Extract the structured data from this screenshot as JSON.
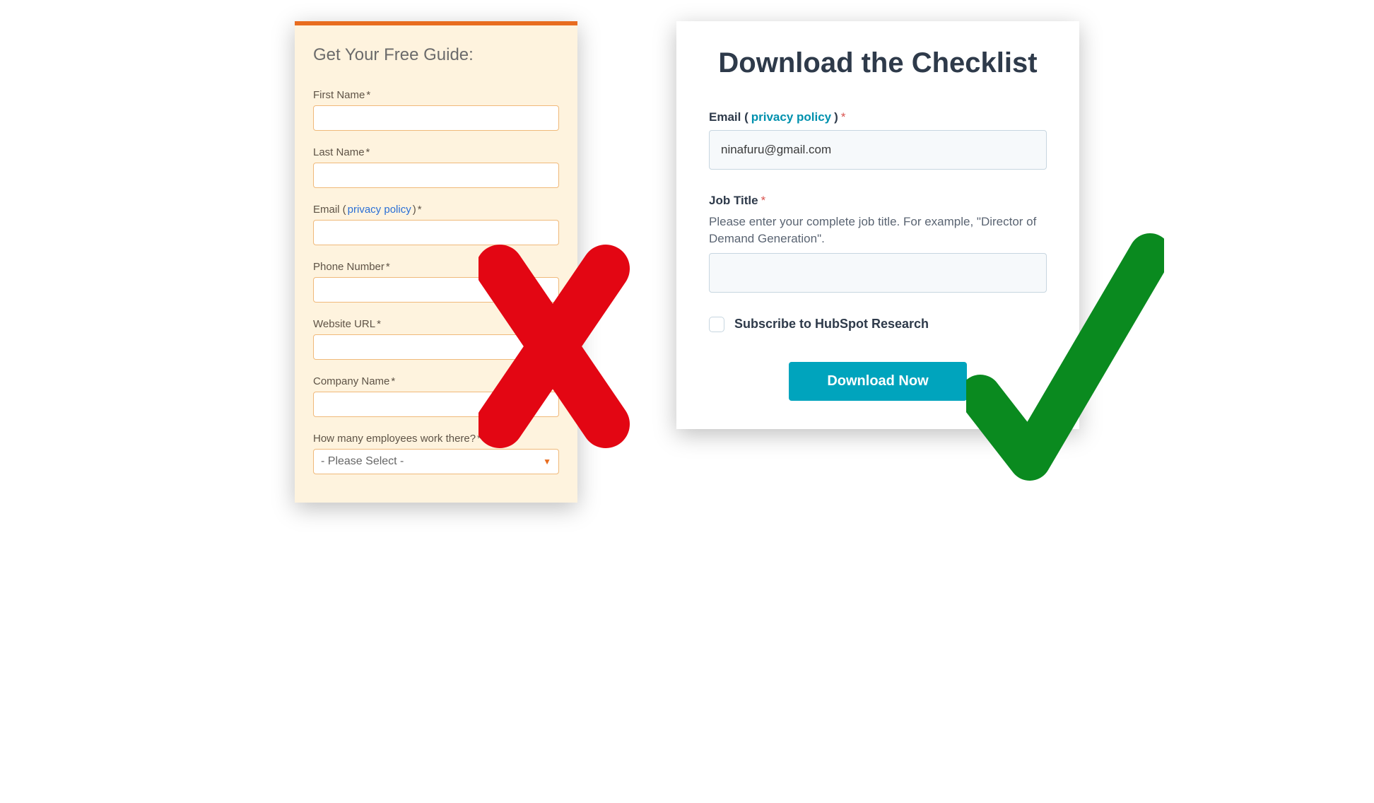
{
  "left_form": {
    "title": "Get Your Free Guide:",
    "fields": {
      "first_name": {
        "label": "First Name",
        "required_glyph": "*"
      },
      "last_name": {
        "label": "Last Name",
        "required_glyph": "*"
      },
      "email": {
        "label_pre": "Email (",
        "privacy_link": "privacy policy",
        "label_post": ")",
        "required_glyph": "*"
      },
      "phone": {
        "label": "Phone Number",
        "required_glyph": "*"
      },
      "website": {
        "label": "Website URL",
        "required_glyph": "*"
      },
      "company": {
        "label": "Company Name",
        "required_glyph": "*"
      },
      "employees": {
        "label": "How many employees work there?",
        "required_glyph": "*",
        "selected": "- Please Select -"
      }
    }
  },
  "right_form": {
    "title": "Download the Checklist",
    "email": {
      "label_pre": "Email (",
      "privacy_link": "privacy policy",
      "label_post": ")",
      "required_glyph": "*",
      "value": "ninafuru@gmail.com"
    },
    "job_title": {
      "label": "Job Title",
      "required_glyph": "*",
      "help": "Please enter your complete job title. For example, \"Director of Demand Generation\"."
    },
    "subscribe_label": "Subscribe to HubSpot Research",
    "button": "Download Now"
  },
  "marks": {
    "x_color": "#e30613",
    "check_color": "#0a8a1f"
  }
}
